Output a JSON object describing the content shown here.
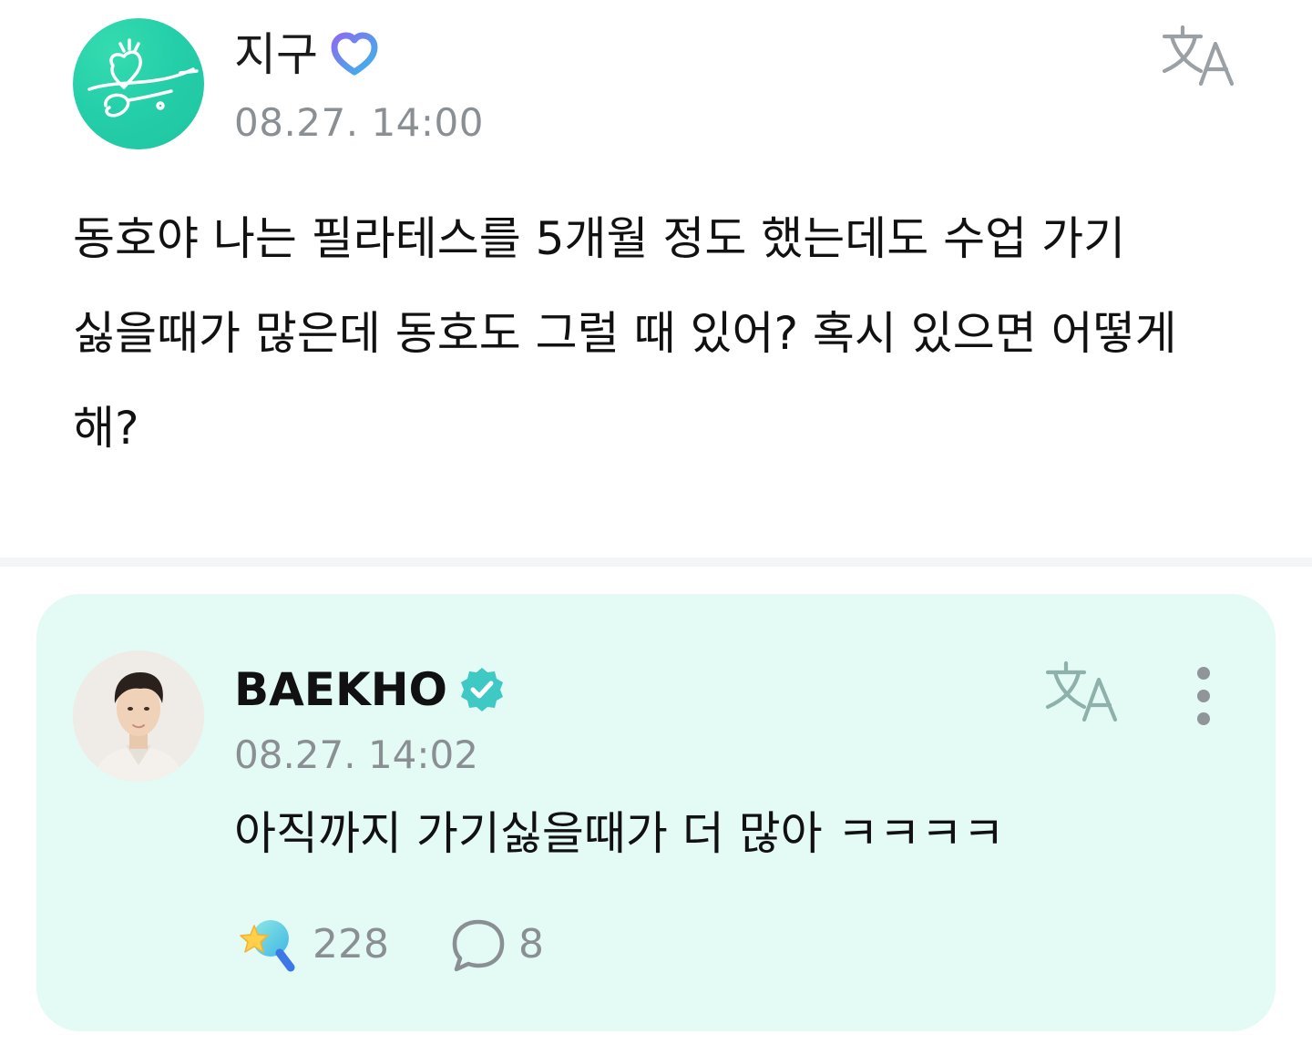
{
  "post": {
    "author": "지구",
    "time": "08.27. 14:00",
    "body": "동호야 나는 필라테스를 5개월 정도 했는데도 수업 가기 싫을때가 많은데 동호도 그럴 때 있어? 혹시 있으면 어떻게 해?",
    "icons": {
      "avatar": "fan-avatar",
      "badge": "fan-heart-badge-icon",
      "translate": "translate-icon"
    }
  },
  "reply": {
    "author": "BAEKHO",
    "time": "08.27. 14:02",
    "body": "아직까지 가기싫을때가 더 많아 ㅋㅋㅋㅋ",
    "like_count": "228",
    "comment_count": "8",
    "icons": {
      "avatar": "artist-avatar",
      "badge": "verified-badge-icon",
      "translate": "translate-icon",
      "more": "more-vertical-icon",
      "like": "lightstick-star-icon",
      "comment": "comment-bubble-icon"
    }
  },
  "colors": {
    "accent": "#2ed3ae",
    "card_background": "#e4faf5",
    "muted_text": "#8a8f93",
    "verified": "#3ec9c4"
  }
}
